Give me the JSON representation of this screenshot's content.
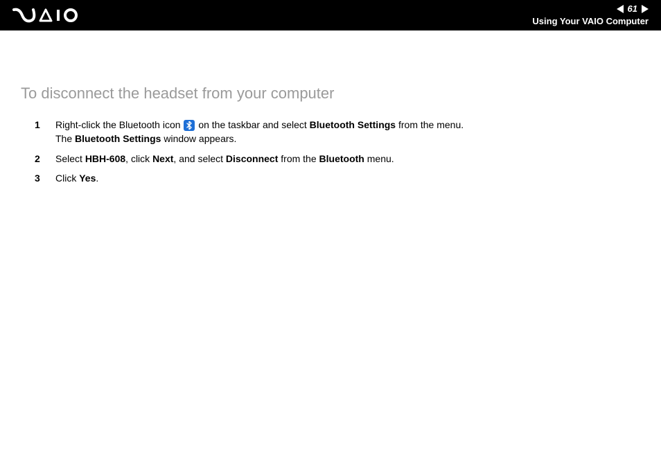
{
  "header": {
    "page_number": "61",
    "section_title": "Using Your VAIO Computer"
  },
  "heading": "To disconnect the headset from your computer",
  "steps": {
    "1": {
      "num": "1",
      "pre_icon": "Right-click the Bluetooth icon ",
      "post_icon_a": " on the taskbar and select ",
      "bold_a": "Bluetooth Settings",
      "post_icon_b": " from the menu.",
      "line2_a": "The ",
      "line2_bold": "Bluetooth Settings",
      "line2_b": " window appears."
    },
    "2": {
      "num": "2",
      "a": "Select ",
      "b1": "HBH-608",
      "b": ", click ",
      "b2": "Next",
      "c": ", and select ",
      "b3": "Disconnect",
      "d": " from the ",
      "b4": "Bluetooth",
      "e": " menu."
    },
    "3": {
      "num": "3",
      "a": "Click ",
      "b1": "Yes",
      "b": "."
    }
  }
}
